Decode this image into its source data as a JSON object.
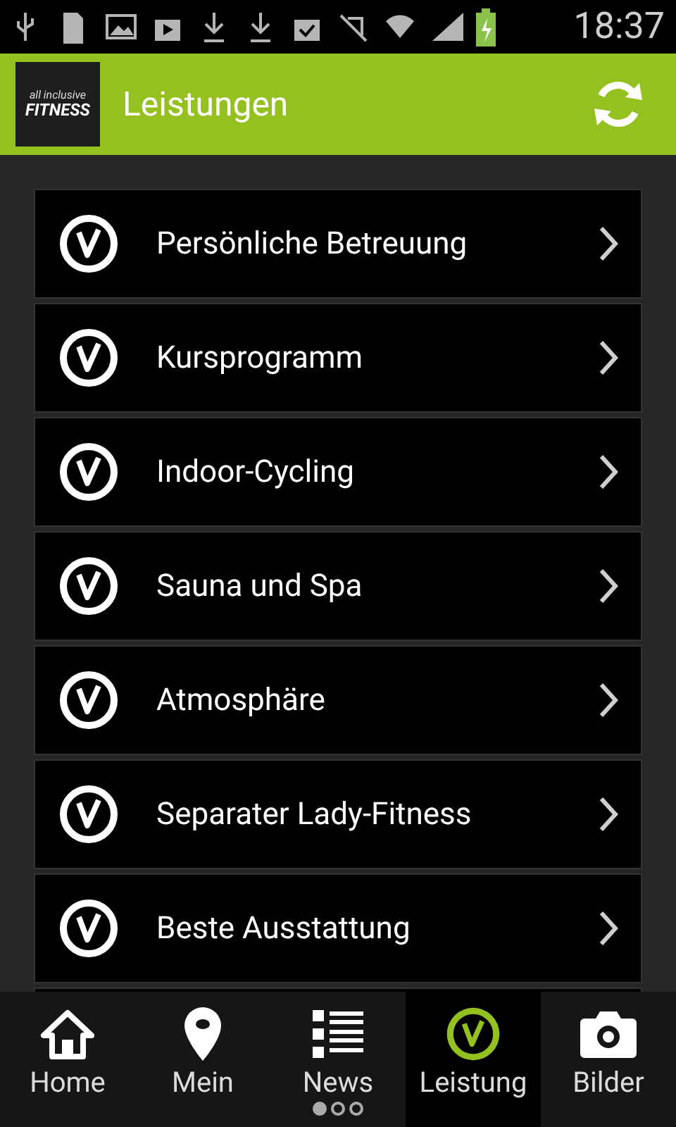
{
  "status_bar": {
    "time": "18:37"
  },
  "header": {
    "logo": {
      "line_1": "all inclusive",
      "line_2": "FITNESS"
    },
    "title": "Leistungen"
  },
  "list": [
    {
      "label": "Persönliche Betreuung"
    },
    {
      "label": "Kursprogramm"
    },
    {
      "label": "Indoor-Cycling"
    },
    {
      "label": "Sauna und Spa"
    },
    {
      "label": "Atmosphäre"
    },
    {
      "label": "Separater Lady-Fitness"
    },
    {
      "label": "Beste Ausstattung"
    }
  ],
  "bottom_nav": [
    {
      "label": "Home",
      "selected": false
    },
    {
      "label": "Mein",
      "selected": false
    },
    {
      "label": "News",
      "selected": false,
      "pages": [
        true,
        false,
        false
      ]
    },
    {
      "label": "Leistung",
      "selected": true
    },
    {
      "label": "Bilder",
      "selected": false
    }
  ]
}
